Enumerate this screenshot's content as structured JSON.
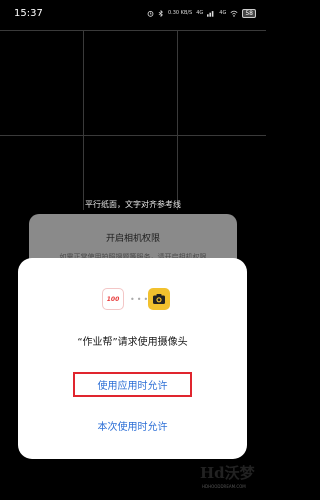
{
  "status_bar": {
    "time": "15:37",
    "battery": "58",
    "network_labels": [
      "0.30 KB/S",
      "4G",
      "4G"
    ]
  },
  "camera_view": {
    "hint": "平行纸面，文字对齐参考线"
  },
  "permission_card": {
    "title": "开启相机权限",
    "subtitle": "如需正常使用拍照搜题等服务，请开启相机权限"
  },
  "dialog": {
    "app_icon_text": "100",
    "question": "“作业帮”请求使用摄像头",
    "allow_while_using_label": "使用应用时允许",
    "allow_once_label": "本次使用时允许"
  },
  "watermark": {
    "main": "Hd沃梦",
    "sub": "HDHOODDREAM.COM"
  },
  "colors": {
    "accent_blue": "#2d6fd6",
    "highlight_red": "#e0252e",
    "camera_yellow": "#f2c12e"
  }
}
